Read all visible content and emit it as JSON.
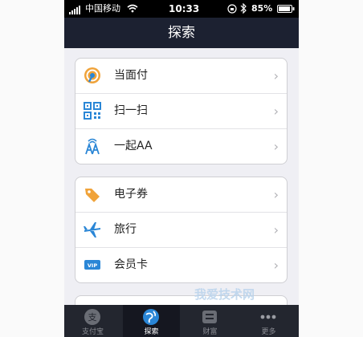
{
  "status_bar": {
    "carrier": "中国移动",
    "time": "10:33",
    "battery": "85%"
  },
  "nav": {
    "title": "探索"
  },
  "groups": [
    {
      "items": [
        {
          "label": "当面付",
          "icon": "orange-signal-icon"
        },
        {
          "label": "扫一扫",
          "icon": "qr-code-icon"
        },
        {
          "label": "一起AA",
          "icon": "aa-tower-icon"
        }
      ]
    },
    {
      "items": [
        {
          "label": "电子券",
          "icon": "coupon-tag-icon"
        },
        {
          "label": "旅行",
          "icon": "airplane-icon"
        },
        {
          "label": "会员卡",
          "icon": "vip-card-icon"
        }
      ]
    }
  ],
  "tabbar": {
    "tabs": [
      {
        "label": "支付宝",
        "icon": "alipay-icon"
      },
      {
        "label": "探索",
        "icon": "explore-globe-icon",
        "active": true
      },
      {
        "label": "财富",
        "icon": "wealth-icon"
      },
      {
        "label": "更多",
        "icon": "more-icon"
      }
    ]
  },
  "watermark": {
    "text": "我爱技术网"
  },
  "colors": {
    "navbar": "#1c2131",
    "tabbar": "#23262f",
    "background": "#efeff4",
    "accent_orange": "#f0a33a",
    "accent_blue": "#2a86d6"
  }
}
